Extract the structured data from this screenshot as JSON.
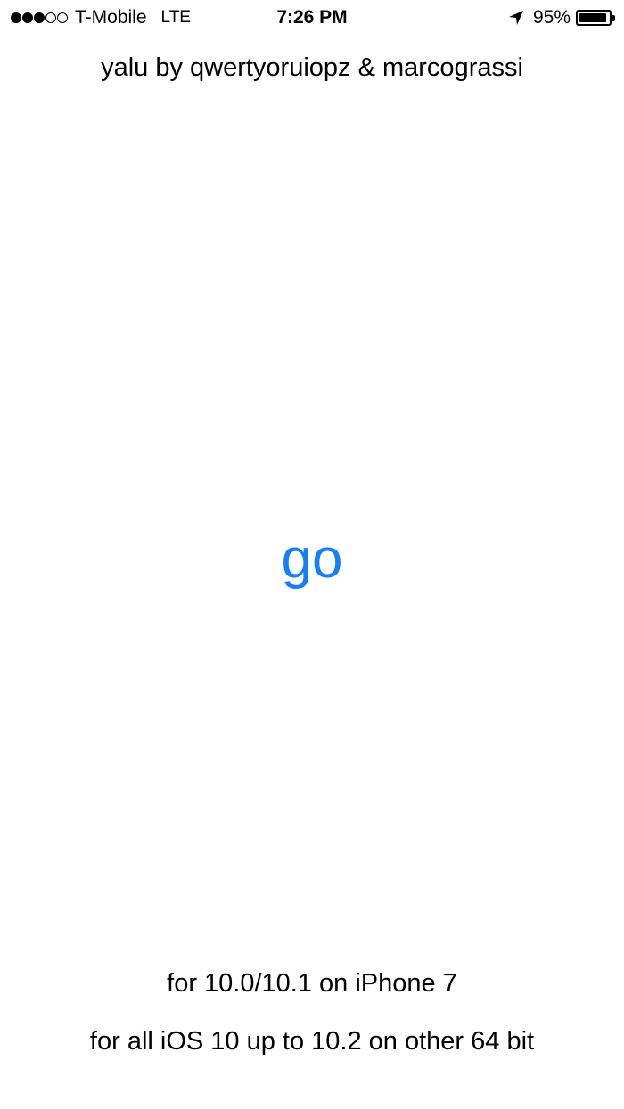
{
  "status_bar": {
    "signal_strength": "3 of 5 bars",
    "carrier": "T-Mobile",
    "network": "LTE",
    "time": "7:26 PM",
    "location_icon": "location-arrow-icon",
    "battery_percent": "95%",
    "battery_level": 0.95
  },
  "credits": "yalu by qwertyoruiopz & marcograssi",
  "go_button": {
    "label": "go",
    "color": "#147EFB"
  },
  "support": {
    "iphone7": "for 10.0/10.1 on iPhone 7",
    "others": "for all iOS 10 up to 10.2 on other 64 bit"
  }
}
